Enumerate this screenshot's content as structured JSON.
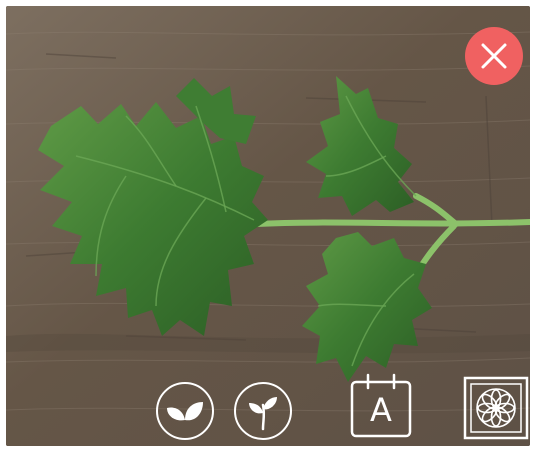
{
  "photo": {
    "subject": "celery-leaves-on-wood",
    "colors": {
      "wood": "#6b5d4f",
      "leaf_dark": "#2f6f2a",
      "leaf_light": "#4b8a3a",
      "stem": "#8cc26a"
    }
  },
  "close_button": {
    "icon": "close-icon",
    "color": "#f06161"
  },
  "toolbar": {
    "leaf_icon": "leaf-icon",
    "sprout_icon": "sprout-icon",
    "calendar": {
      "icon": "calendar-icon",
      "letter": "A"
    },
    "pattern_icon": "flower-pattern-icon"
  }
}
